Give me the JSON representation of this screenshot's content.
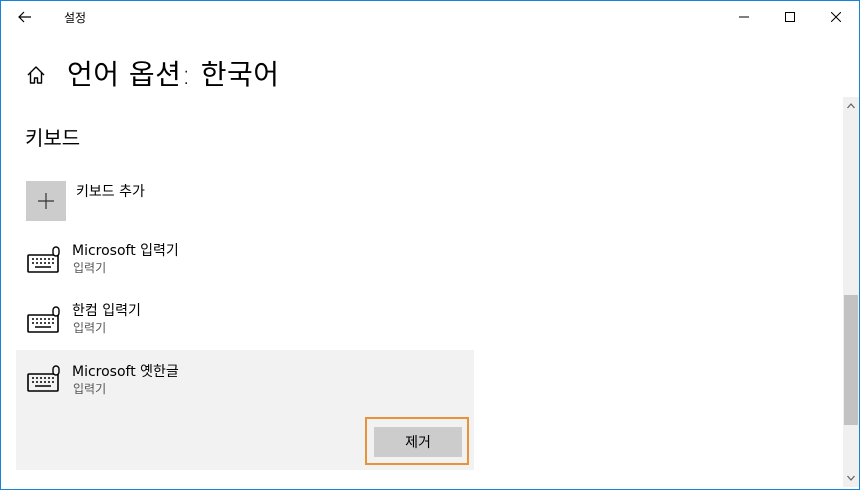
{
  "window": {
    "title": "설정",
    "icons": {
      "back": "back-arrow-icon",
      "minimize": "minimize-icon",
      "maximize": "maximize-icon",
      "close": "close-icon"
    }
  },
  "header": {
    "title": "언어 옵션: 한국어",
    "home_icon": "home-icon"
  },
  "keyboards": {
    "section_title": "키보드",
    "add_label": "키보드 추가",
    "items": [
      {
        "name": "Microsoft 입력기",
        "subtitle": "입력기",
        "icon": "keyboard-icon"
      },
      {
        "name": "한컴 입력기",
        "subtitle": "입력기",
        "icon": "keyboard-icon"
      },
      {
        "name": "Microsoft 옛한글",
        "subtitle": "입력기",
        "icon": "keyboard-icon",
        "selected": true
      }
    ],
    "remove_label": "제거"
  },
  "colors": {
    "window_border": "#1883d7",
    "selected_bg": "#f2f2f2",
    "tile_gray": "#cccccc",
    "focus_outline": "#e8923a"
  }
}
